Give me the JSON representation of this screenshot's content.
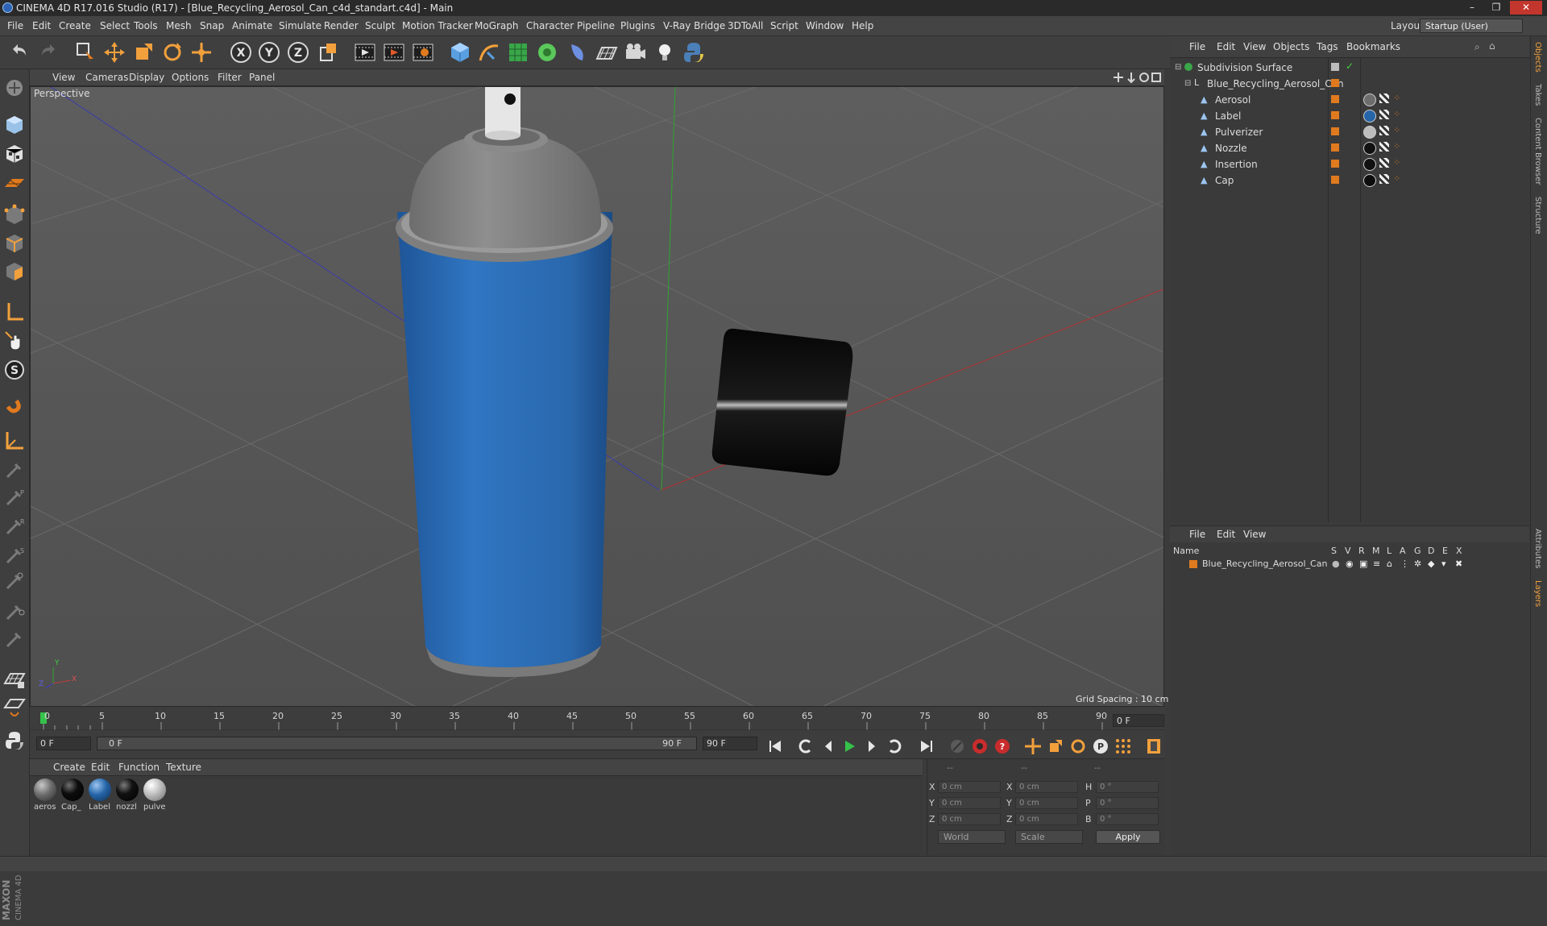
{
  "window": {
    "title": "CINEMA 4D R17.016 Studio (R17) - [Blue_Recycling_Aerosol_Can_c4d_standart.c4d] - Main",
    "minimize_label": "–",
    "maximize_label": "❐",
    "close_label": "✕"
  },
  "menubar": {
    "items": [
      "File",
      "Edit",
      "Create",
      "Select",
      "Tools",
      "Mesh",
      "Snap",
      "Animate",
      "Simulate",
      "Render",
      "Sculpt",
      "Motion Tracker",
      "MoGraph",
      "Character",
      "Pipeline",
      "Plugins",
      "V-Ray Bridge",
      "3DToAll",
      "Script",
      "Window",
      "Help"
    ],
    "layout_label": "Layout:",
    "layout_value": "Startup (User)"
  },
  "toolbar": {
    "icons": [
      "undo-icon",
      "redo-icon",
      "live-selection-icon",
      "move-icon",
      "scale-icon",
      "rotate-icon",
      "recent-tool-icon",
      "x-axis-lock-icon",
      "y-axis-lock-icon",
      "z-axis-lock-icon",
      "coordinate-system-icon",
      "render-view-icon",
      "render-picture-viewer-icon",
      "edit-render-settings-icon",
      "cube-icon",
      "pen-spline-icon",
      "subdivision-surface-icon",
      "cloner-icon",
      "deformer-icon",
      "floor-icon",
      "camera-icon",
      "light-icon",
      "python-icon"
    ]
  },
  "viewport": {
    "menu": [
      "View",
      "Cameras",
      "Display",
      "Options",
      "Filter",
      "Panel"
    ],
    "label": "Perspective",
    "grid_spacing": "Grid Spacing : 10 cm",
    "axis_x": "X",
    "axis_y": "Y",
    "axis_z": "Z"
  },
  "timeline": {
    "ticks": [
      "0",
      "5",
      "10",
      "15",
      "20",
      "25",
      "30",
      "35",
      "40",
      "45",
      "50",
      "55",
      "60",
      "65",
      "70",
      "75",
      "80",
      "85",
      "90"
    ],
    "current_frame": "0 F",
    "start_field": "0 F",
    "range_start": "0 F",
    "range_end": "90 F",
    "end_field": "90 F"
  },
  "material_manager": {
    "menu": [
      "Create",
      "Edit",
      "Function",
      "Texture"
    ],
    "materials": [
      {
        "label": "aeros",
        "color": "#6d6d6d"
      },
      {
        "label": "Cap_",
        "color": "#0d0d0d"
      },
      {
        "label": "Label",
        "color": "#2565a8"
      },
      {
        "label": "nozzl",
        "color": "#111111"
      },
      {
        "label": "pulve",
        "color": "#bcbcbc"
      }
    ]
  },
  "coordinates": {
    "header_a": "--",
    "header_b": "--",
    "header_c": "--",
    "rows": [
      {
        "l1": "X",
        "v1": "0 cm",
        "l2": "X",
        "v2": "0 cm",
        "l3": "H",
        "v3": "0 °"
      },
      {
        "l1": "Y",
        "v1": "0 cm",
        "l2": "Y",
        "v2": "0 cm",
        "l3": "P",
        "v3": "0 °"
      },
      {
        "l1": "Z",
        "v1": "0 cm",
        "l2": "Z",
        "v2": "0 cm",
        "l3": "B",
        "v3": "0 °"
      }
    ],
    "space": "World",
    "mode": "Scale",
    "apply": "Apply"
  },
  "object_manager": {
    "menu": [
      "File",
      "Edit",
      "View",
      "Objects",
      "Tags",
      "Bookmarks"
    ],
    "objects": [
      {
        "name": "Subdivision Surface",
        "mat": null
      },
      {
        "name": "Blue_Recycling_Aerosol_Can",
        "mat": null
      },
      {
        "name": "Aerosol",
        "mat": "#6d6d6d"
      },
      {
        "name": "Label",
        "mat": "#2565a8"
      },
      {
        "name": "Pulverizer",
        "mat": "#bcbcbc"
      },
      {
        "name": "Nozzle",
        "mat": "#111111"
      },
      {
        "name": "Insertion",
        "mat": "#111111"
      },
      {
        "name": "Cap",
        "mat": "#0d0d0d"
      }
    ]
  },
  "layer_manager": {
    "menu": [
      "File",
      "Edit",
      "View"
    ],
    "header_name": "Name",
    "columns": [
      "S",
      "V",
      "R",
      "M",
      "L",
      "A",
      "G",
      "D",
      "E",
      "X"
    ],
    "layer_name": "Blue_Recycling_Aerosol_Can"
  },
  "right_tabs": [
    "Objects",
    "Takes",
    "Content Browser",
    "Structure",
    "Attributes",
    "Layers"
  ],
  "colors": {
    "accent_orange": "#e07a1f",
    "can_blue": "#2f6db3",
    "viewport_bg": "#5a5a5a"
  }
}
